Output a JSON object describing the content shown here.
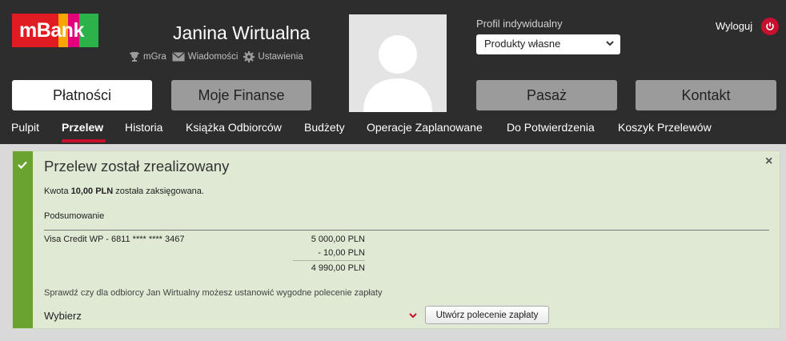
{
  "header": {
    "logo_text": "mBank",
    "user_name": "Janina Wirtualna",
    "links": [
      "mGra",
      "Wiadomości",
      "Ustawienia"
    ],
    "profile_label": "Profil indywidualny",
    "profile_selected": "Produkty własne",
    "logout_label": "Wyloguj"
  },
  "main_nav": [
    "Płatności",
    "Moje Finanse",
    "Pasaż",
    "Kontakt"
  ],
  "sub_nav": [
    "Pulpit",
    "Przelew",
    "Historia",
    "Książka Odbiorców",
    "Budżety",
    "Operacje Zaplanowane",
    "Do Potwierdzenia",
    "Koszyk Przelewów"
  ],
  "active_sub_nav": "Przelew",
  "notice": {
    "title": "Przelew został zrealizowany",
    "amount_prefix": "Kwota",
    "amount_value": "10,00 PLN",
    "amount_suffix": "została zaksięgowana.",
    "summary_label": "Podsumowanie",
    "account": "Visa Credit WP - 6811 **** **** 3467",
    "balance_before": "5 000,00 PLN",
    "debit": "- 10,00 PLN",
    "balance_after": "4 990,00 PLN",
    "hint": "Sprawdź czy dla odbiorcy Jan Wirtualny możesz ustanowić wygodne polecenie zapłaty",
    "select_value": "Wybierz",
    "create_button": "Utwórz polecenie zapłaty"
  },
  "colors": {
    "topbar": "#2d2d2d",
    "accent_red": "#c8102e",
    "success_green": "#6aa32f",
    "panel_bg": "#dfe9d3"
  }
}
